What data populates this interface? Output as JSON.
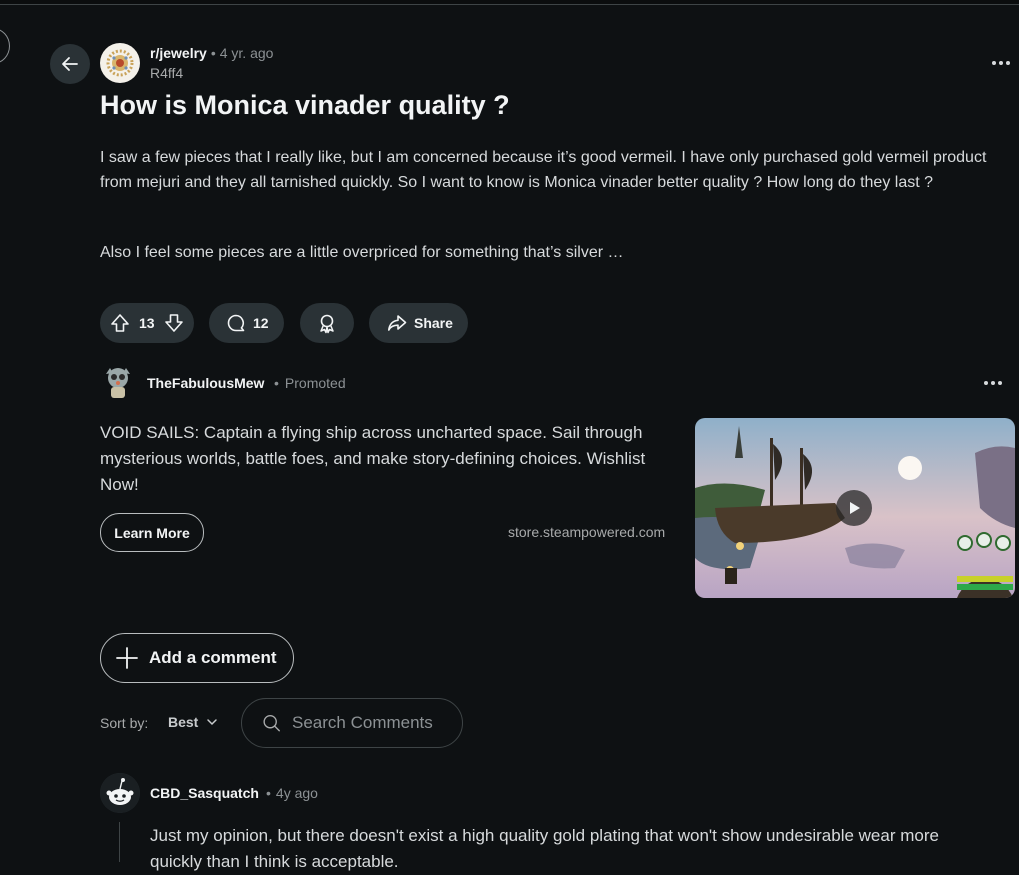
{
  "post": {
    "subreddit": "r/jewelry",
    "time": "4 yr. ago",
    "author": "R4ff4",
    "title": "How is Monica vinader quality ?",
    "body": [
      "I saw a few pieces that I really like, but I am concerned because it’s good vermeil. I have only purchased gold vermeil product from mejuri and they all tarnished quickly. So I want to know is Monica vinader better quality ? How long do they last ?",
      "Also I feel some pieces are a little overpriced for something that’s silver …"
    ],
    "actions": {
      "votes": "13",
      "comments": "12",
      "share_label": "Share"
    }
  },
  "promo": {
    "name": "TheFabulousMew",
    "tag": "Promoted",
    "text": "VOID SAILS: Captain a flying ship across uncharted space. Sail through mysterious worlds, battle foes, and make story-defining choices. Wishlist Now!",
    "cta": "Learn More",
    "domain": "store.steampowered.com"
  },
  "comments_section": {
    "add_comment_label": "Add a comment",
    "sort_label": "Sort by:",
    "sort_value": "Best",
    "search_placeholder": "Search Comments"
  },
  "comments": [
    {
      "author": "CBD_Sasquatch",
      "time": "4y ago",
      "text": "Just my opinion, but there doesn't exist a high quality gold plating that won't show undesirable wear more quickly than I think is acceptable."
    }
  ],
  "colors": {
    "background": "#0e1113",
    "button_bg": "#2a3236",
    "text": "#d7dadc",
    "muted": "#8c9194"
  }
}
